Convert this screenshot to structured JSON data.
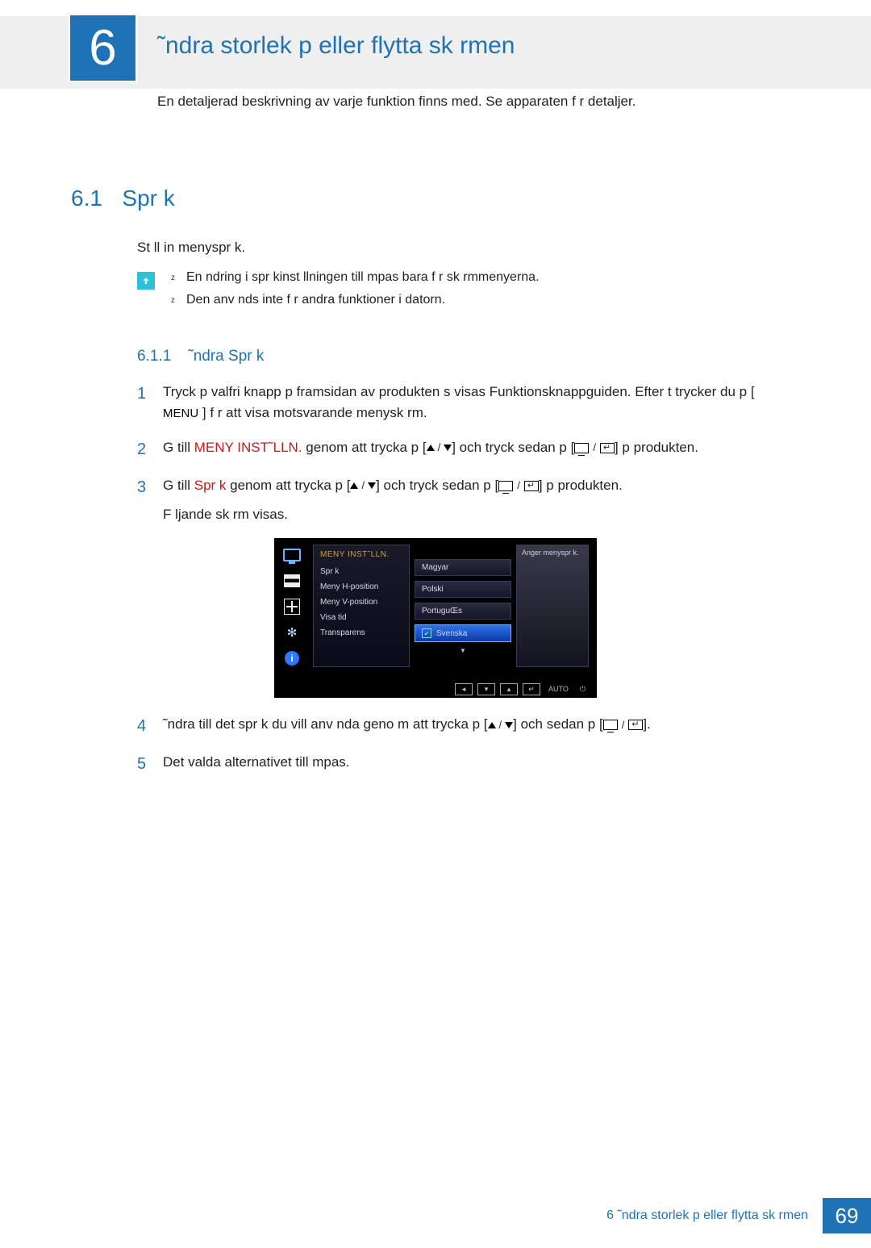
{
  "chapter": {
    "number": "6",
    "title": "˜ndra storlek p  eller flytta sk rmen",
    "description": "En detaljerad beskrivning av varje funktion finns med. Se apparaten f r detaljer."
  },
  "section": {
    "number": "6.1",
    "title": "Spr k",
    "intro": "St ll in menyspr k.",
    "notes": [
      "En  ndring i spr kinst llningen till mpas bara f r sk rmmenyerna.",
      "Den anv nds inte f r andra funktioner i datorn."
    ],
    "subsection": {
      "number": "6.1.1",
      "title": "˜ndra Spr k"
    }
  },
  "steps": {
    "s1": {
      "num": "1",
      "part_a": "Tryck p  valfri knapp p  framsidan av produkten s  visas Funktionsknappguiden. Efter t trycker du p  [",
      "menu_label": "MENU",
      "part_b": "] f r att visa  motsvarande menysk rm."
    },
    "s2": {
      "num": "2",
      "part_a": "G  till ",
      "red": "MENY INST˜LLN.",
      "part_b": "  genom att trycka p  [",
      "part_c": "] och tryck sedan p  [",
      "part_d": "] p  produkten."
    },
    "s3": {
      "num": "3",
      "part_a": "G  till ",
      "red": "Spr k",
      "part_b": "  genom att trycka p  [",
      "part_c": "] och tryck sedan p  [",
      "part_d": "] p  produkten.",
      "tail": "F ljande sk rm visas."
    },
    "s4": {
      "num": "4",
      "part_a": "˜ndra till det spr k du vill anv nda geno m att trycka p  [",
      "part_b": "]  och sedan p  [",
      "part_c": "]."
    },
    "s5": {
      "num": "5",
      "text": "Det valda alternativet till mpas."
    }
  },
  "osd": {
    "category_title": "MENY INST˜LLN.",
    "col1": [
      "Spr k",
      "Meny H-position",
      "Meny V-position",
      "Visa tid",
      "Transparens"
    ],
    "options": [
      "Magyar",
      "Polski",
      "PortuguŒs",
      "Svenska"
    ],
    "selected_option": "Svenska",
    "hint_text": "Anger menyspr k.",
    "bottom_buttons": [
      "◂",
      "▾",
      "▴",
      "↵"
    ],
    "bottom_auto": "AUTO"
  },
  "footer": {
    "text": "6 ˜ndra storlek p  eller flytta sk rmen",
    "page": "69"
  }
}
